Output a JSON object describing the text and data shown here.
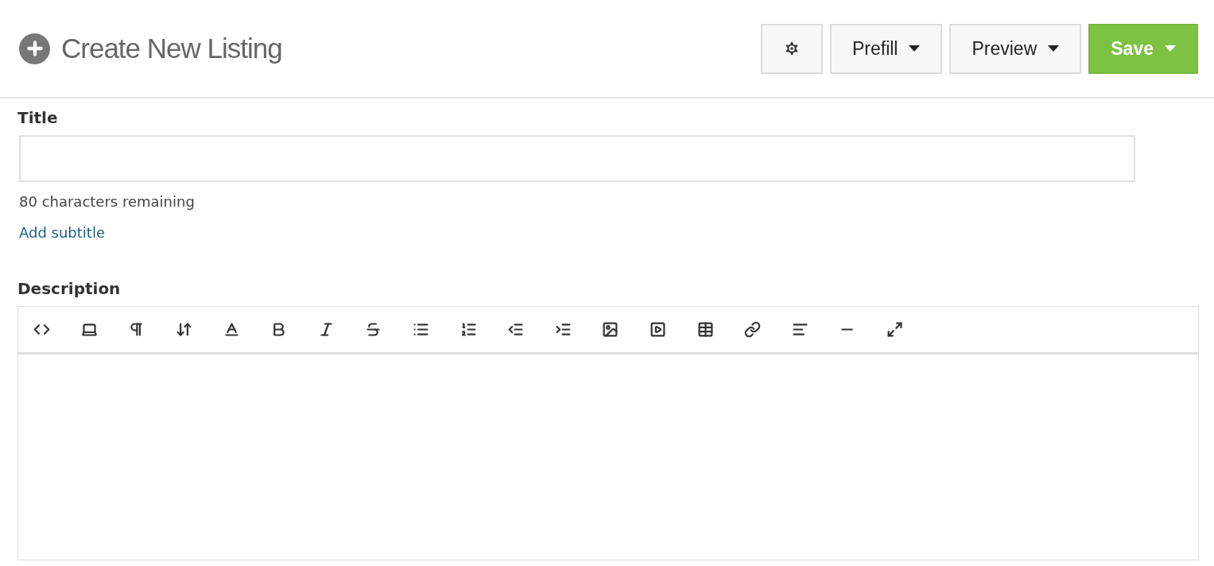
{
  "header": {
    "title": "Create New Listing",
    "buttons": [
      {
        "kind": "settings"
      },
      {
        "kind": "dropdown",
        "label": "Prefill"
      },
      {
        "kind": "dropdown",
        "label": "Preview"
      },
      {
        "kind": "primary",
        "label": "Save"
      }
    ]
  },
  "title_field": {
    "label": "Title",
    "counter": "80 characters remaining",
    "link": "Add subtitle"
  },
  "description": {
    "label": "Description"
  }
}
